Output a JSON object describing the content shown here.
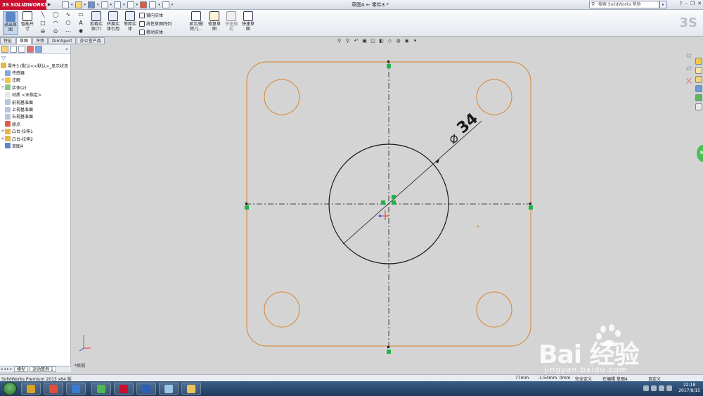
{
  "titlebar": {
    "brand": "SOLIDWORKS",
    "document_title": "草图4 ← 零件3 *",
    "search_placeholder": "搜索 SolidWorks 帮助"
  },
  "ribbon": {
    "buttons": {
      "exit_sketch": "退出草图",
      "smart_dim": "智能尺寸",
      "trim": "剪裁实体(T)",
      "convert": "转换实体引用",
      "offset": "等距实体",
      "mirror": "镜向实体",
      "linear_pattern": "线性草图阵列",
      "move": "移动实体",
      "display_relations": "显示/删除几...",
      "repair": "修复草图",
      "quick_snaps": "快速捕捉",
      "rapid_sketch": "快速草图"
    }
  },
  "tabs": [
    "特征",
    "草图",
    "评估",
    "DimXpert",
    "办公室产品"
  ],
  "active_tab": 1,
  "feature_tree": {
    "root": "零件3 (默认<<默认>_显示状态",
    "items": [
      {
        "label": "传感器",
        "expand": ""
      },
      {
        "label": "注解",
        "expand": "+"
      },
      {
        "label": "实体(2)",
        "expand": "+"
      },
      {
        "label": "材质 <未指定>",
        "expand": ""
      },
      {
        "label": "前视基准面",
        "expand": ""
      },
      {
        "label": "上视基准面",
        "expand": ""
      },
      {
        "label": "右视基准面",
        "expand": ""
      },
      {
        "label": "原点",
        "expand": ""
      },
      {
        "label": "凸台-拉伸1",
        "expand": "+"
      },
      {
        "label": "凸台-拉伸2",
        "expand": "+"
      },
      {
        "label": "草图4",
        "expand": ""
      }
    ]
  },
  "bottom_tabs": [
    "模型",
    "运动算例 1"
  ],
  "canvas": {
    "view_label": "*后视",
    "dimension": "34",
    "diameter_symbol": "⌀"
  },
  "statusbar": {
    "app": "SolidWorks Premium 2013 x64 版",
    "x": "77mm",
    "y": "-1.54mm",
    "z": "0mm",
    "state": "完全定义",
    "editing": "在编辑 草图4",
    "custom": "自定义"
  },
  "watermark": {
    "text": "Bai 经验",
    "url": "jingyan.baidu.com"
  },
  "taskbar": {
    "time": "22:18",
    "date": "2017/8/15"
  },
  "colors": {
    "sketch_orange": "#d9822b",
    "sketch_black": "#1a1a1a",
    "constraint_green": "#22b24c",
    "canvas_bg": "#d4d4d4",
    "brand_red": "#c8102e"
  }
}
